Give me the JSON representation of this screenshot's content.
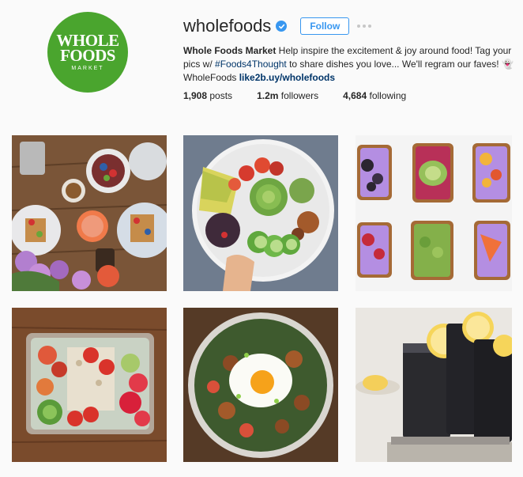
{
  "profile": {
    "avatar_line1": "WHOLE",
    "avatar_line2": "FOODS",
    "avatar_line3": "MARKET",
    "username": "wholefoods",
    "follow_label": "Follow",
    "bio_name": "Whole Foods Market",
    "bio_text1": " Help inspire the excitement & joy around food! Tag your pics w/ ",
    "bio_hashtag": "#Foods4Thought",
    "bio_text2": " to share dishes you love... We'll regram our faves! 👻 WholeFoods ",
    "bio_link": "like2b.uy/wholefoods",
    "stats": {
      "posts_count": "1,908",
      "posts_label": "posts",
      "followers_count": "1.2m",
      "followers_label": "followers",
      "following_count": "4,684",
      "following_label": "following"
    }
  },
  "icons": {
    "verified": "verified-badge-icon",
    "more": "more-options-icon"
  },
  "colors": {
    "brand_green": "#4aa52e",
    "accent_blue": "#3897f0"
  }
}
